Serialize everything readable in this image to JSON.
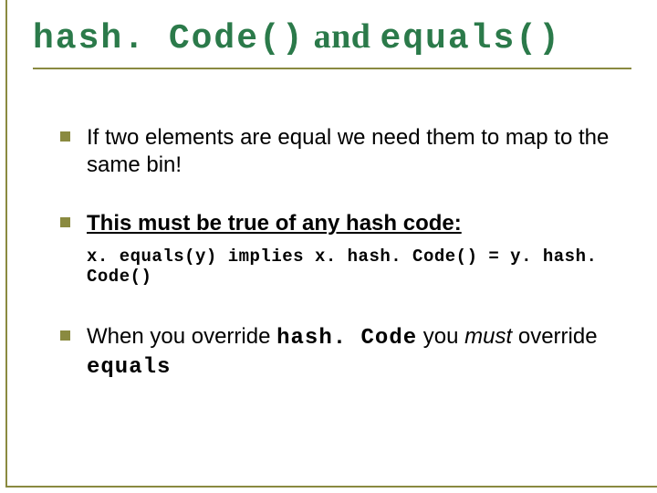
{
  "title": {
    "part1": "hash. Code()",
    "connector": " and ",
    "part2": "equals()"
  },
  "bullets": [
    {
      "text": "If two elements are equal we need them to map to the same bin!"
    },
    {
      "text_underlined": "This must be true of any hash code:"
    },
    {
      "pre": "When you override ",
      "code1": "hash. Code",
      "mid": " you ",
      "ital": "must",
      "post": " override ",
      "code2": "equals"
    }
  ],
  "code_example": "x. equals(y) implies x. hash. Code() = y. hash. Code()"
}
